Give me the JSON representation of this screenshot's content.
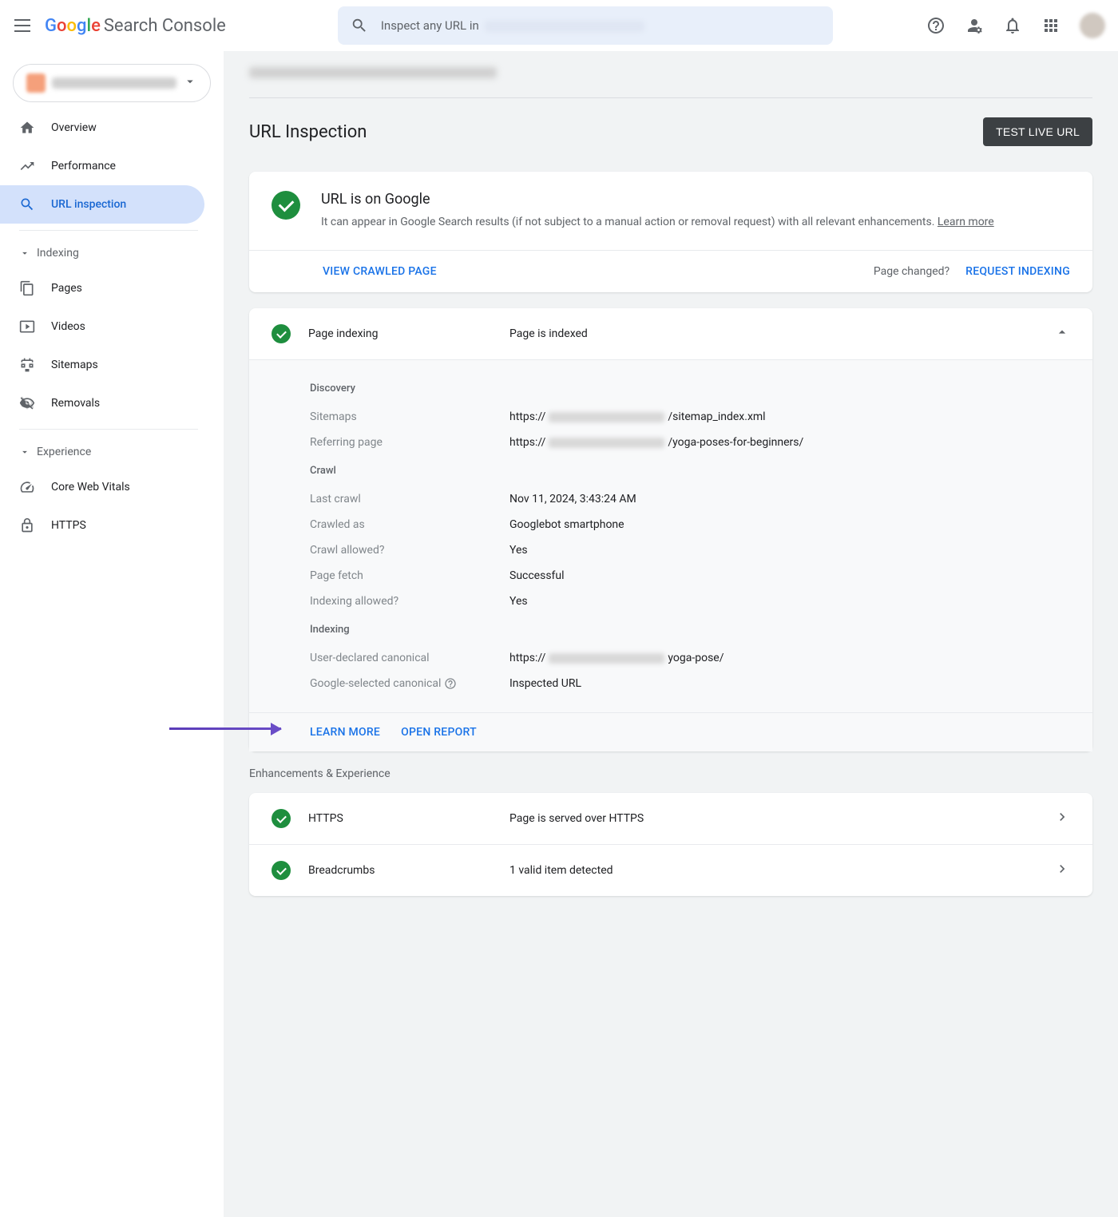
{
  "header": {
    "product_name": "Search Console",
    "search_placeholder": "Inspect any URL in"
  },
  "sidebar": {
    "items": {
      "overview": "Overview",
      "performance": "Performance",
      "url_inspection": "URL inspection"
    },
    "sections": {
      "indexing": "Indexing",
      "experience": "Experience"
    },
    "indexing_items": {
      "pages": "Pages",
      "videos": "Videos",
      "sitemaps": "Sitemaps",
      "removals": "Removals"
    },
    "experience_items": {
      "cwv": "Core Web Vitals",
      "https": "HTTPS"
    }
  },
  "page": {
    "title": "URL Inspection",
    "test_btn": "TEST LIVE URL"
  },
  "verdict": {
    "title": "URL is on Google",
    "subtitle_a": "It can appear in Google Search results (if not subject to a manual action or removal request) with all relevant enhancements. ",
    "learn_more": "Learn more",
    "view_crawled": "VIEW CRAWLED PAGE",
    "page_changed": "Page changed?",
    "request_indexing": "REQUEST INDEXING"
  },
  "indexing_panel": {
    "label": "Page indexing",
    "value": "Page is indexed",
    "sections": {
      "discovery": "Discovery",
      "crawl": "Crawl",
      "indexing": "Indexing"
    },
    "discovery": {
      "sitemaps_label": "Sitemaps",
      "sitemaps_prefix": "https://",
      "sitemaps_suffix": "/sitemap_index.xml",
      "referring_label": "Referring page",
      "referring_prefix": "https://",
      "referring_suffix": "/yoga-poses-for-beginners/"
    },
    "crawl": {
      "last_crawl_label": "Last crawl",
      "last_crawl_value": "Nov 11, 2024, 3:43:24 AM",
      "crawled_as_label": "Crawled as",
      "crawled_as_value": "Googlebot smartphone",
      "crawl_allowed_label": "Crawl allowed?",
      "crawl_allowed_value": "Yes",
      "page_fetch_label": "Page fetch",
      "page_fetch_value": "Successful",
      "indexing_allowed_label": "Indexing allowed?",
      "indexing_allowed_value": "Yes"
    },
    "indexing": {
      "user_canonical_label": "User-declared canonical",
      "user_canonical_prefix": "https://",
      "user_canonical_suffix": "yoga-pose/",
      "google_canonical_label": "Google-selected canonical",
      "google_canonical_value": "Inspected URL"
    },
    "footer": {
      "learn_more": "LEARN MORE",
      "open_report": "OPEN REPORT"
    }
  },
  "enhancements": {
    "header": "Enhancements & Experience",
    "https_label": "HTTPS",
    "https_value": "Page is served over HTTPS",
    "breadcrumbs_label": "Breadcrumbs",
    "breadcrumbs_value": "1 valid item detected"
  }
}
